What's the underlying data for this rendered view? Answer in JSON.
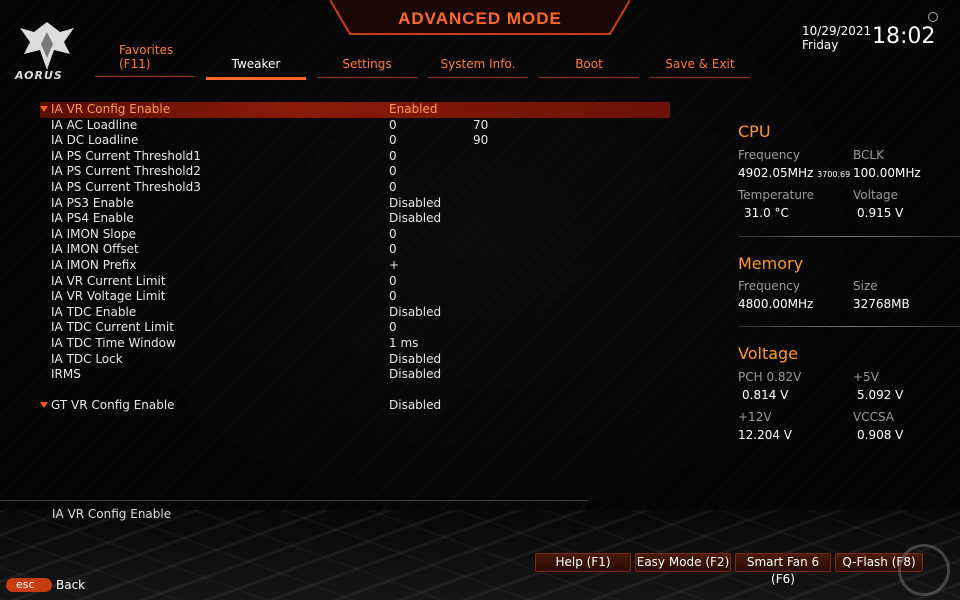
{
  "header": {
    "title": "ADVANCED MODE",
    "logo_text": "AORUS",
    "date": "10/29/2021",
    "day": "Friday",
    "time": "18:02",
    "tabs": [
      {
        "label_line1": "Favorites",
        "label_line2": "(F11)"
      },
      {
        "label": "Tweaker"
      },
      {
        "label": "Settings"
      },
      {
        "label": "System Info."
      },
      {
        "label": "Boot"
      },
      {
        "label": "Save & Exit"
      }
    ],
    "active_tab": "Tweaker"
  },
  "settings": {
    "ia_vr": {
      "label": "IA VR Config Enable",
      "value": "Enabled"
    },
    "rows": [
      {
        "label": "IA AC Loadline",
        "value": "0",
        "value2": "70"
      },
      {
        "label": "IA DC Loadline",
        "value": "0",
        "value2": "90"
      },
      {
        "label": "IA PS Current Threshold1",
        "value": "0"
      },
      {
        "label": "IA PS Current Threshold2",
        "value": "0"
      },
      {
        "label": "IA PS Current Threshold3",
        "value": "0"
      },
      {
        "label": "IA PS3 Enable",
        "value": "Disabled"
      },
      {
        "label": "IA PS4 Enable",
        "value": "Disabled"
      },
      {
        "label": "IA IMON Slope",
        "value": "0"
      },
      {
        "label": "IA IMON Offset",
        "value": "0"
      },
      {
        "label": "IA IMON Prefix",
        "value": "+"
      },
      {
        "label": "IA VR Current Limit",
        "value": "0"
      },
      {
        "label": "IA VR Voltage Limit",
        "value": "0"
      },
      {
        "label": "IA TDC Enable",
        "value": "Disabled"
      },
      {
        "label": "IA TDC Current Limit",
        "value": "0"
      },
      {
        "label": "IA TDC Time Window",
        "value": "1 ms"
      },
      {
        "label": "IA TDC Lock",
        "value": "Disabled"
      },
      {
        "label": "IRMS",
        "value": "Disabled"
      }
    ],
    "gt_vr": {
      "label": "GT VR Config Enable",
      "value": "Disabled"
    }
  },
  "panel": {
    "cpu": {
      "title": "CPU",
      "freq_label": "Frequency",
      "freq_value": "4902.05MHz",
      "freq_sub": "3700.69",
      "bclk_label": "BCLK",
      "bclk_value": "100.00MHz",
      "temp_label": "Temperature",
      "temp_value": "31.0 °C",
      "volt_label": "Voltage",
      "volt_value": "0.915 V"
    },
    "memory": {
      "title": "Memory",
      "freq_label": "Frequency",
      "freq_value": "4800.00MHz",
      "size_label": "Size",
      "size_value": "32768MB"
    },
    "voltage": {
      "title": "Voltage",
      "pch_label": "PCH 0.82V",
      "pch_value": "0.814 V",
      "v5_label": "+5V",
      "v5_value": "5.092 V",
      "v12_label": "+12V",
      "v12_value": "12.204 V",
      "vccsa_label": "VCCSA",
      "vccsa_value": "0.908 V"
    }
  },
  "footer": {
    "help_text": "IA VR Config Enable",
    "buttons": [
      "Help (F1)",
      "Easy Mode (F2)",
      "Smart Fan 6 (F6)",
      "Q-Flash (F8)"
    ],
    "esc_label": "esc",
    "back_label": "Back"
  },
  "colors": {
    "accent": "#ff6a2a",
    "selected_bg": "#8a1a08",
    "section_title": "#ff9a2a"
  }
}
